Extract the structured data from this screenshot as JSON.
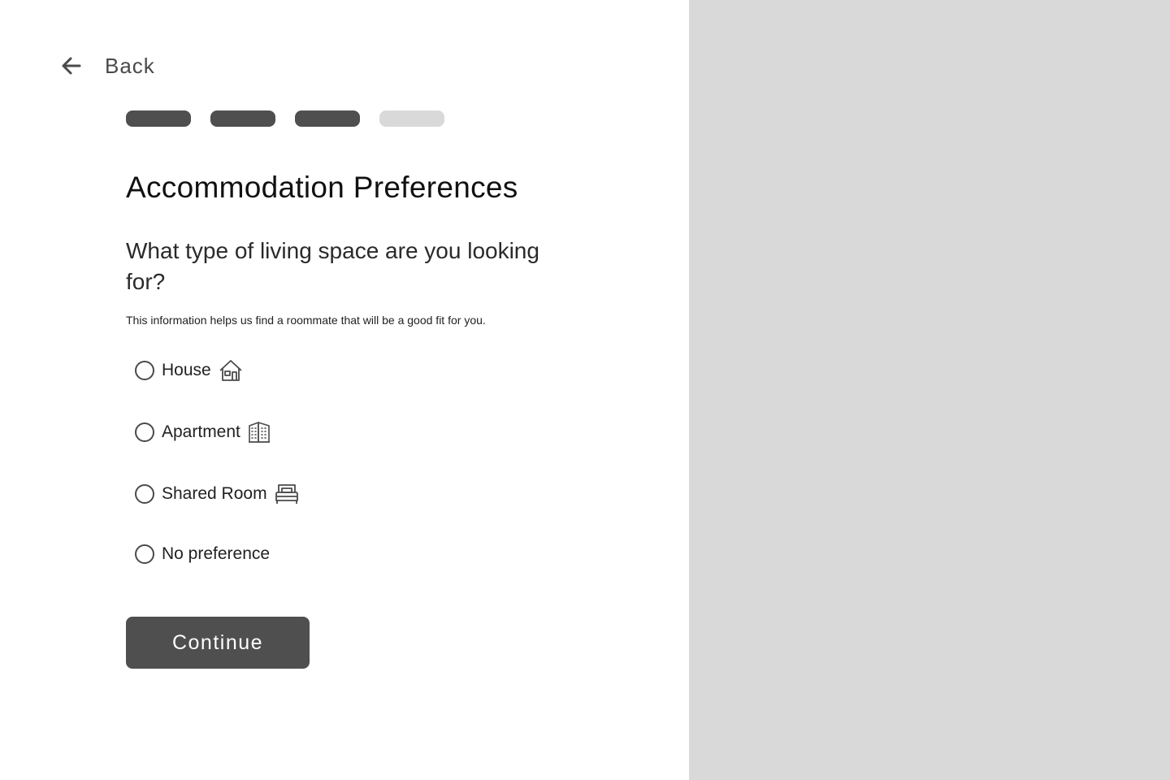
{
  "nav": {
    "back_label": "Back",
    "back_icon": "arrow-left-icon"
  },
  "progress": {
    "total_steps": 4,
    "completed_steps": 3
  },
  "page": {
    "title": "Accommodation Preferences",
    "question": "What type of living space are you looking for?",
    "helper": "This information helps us find a roommate that will be a good fit for you."
  },
  "options": [
    {
      "label": "House",
      "icon": "house-icon",
      "selected": false
    },
    {
      "label": "Apartment",
      "icon": "apartment-building-icon",
      "selected": false
    },
    {
      "label": "Shared Room",
      "icon": "bed-icon",
      "selected": false
    },
    {
      "label": "No preference",
      "icon": "",
      "selected": false
    }
  ],
  "actions": {
    "continue_label": "Continue"
  },
  "colors": {
    "primary": "#4f4f4f",
    "inactive": "#d9d9d9",
    "side_panel": "#d9d9d9",
    "text": "#1f1f1f"
  }
}
